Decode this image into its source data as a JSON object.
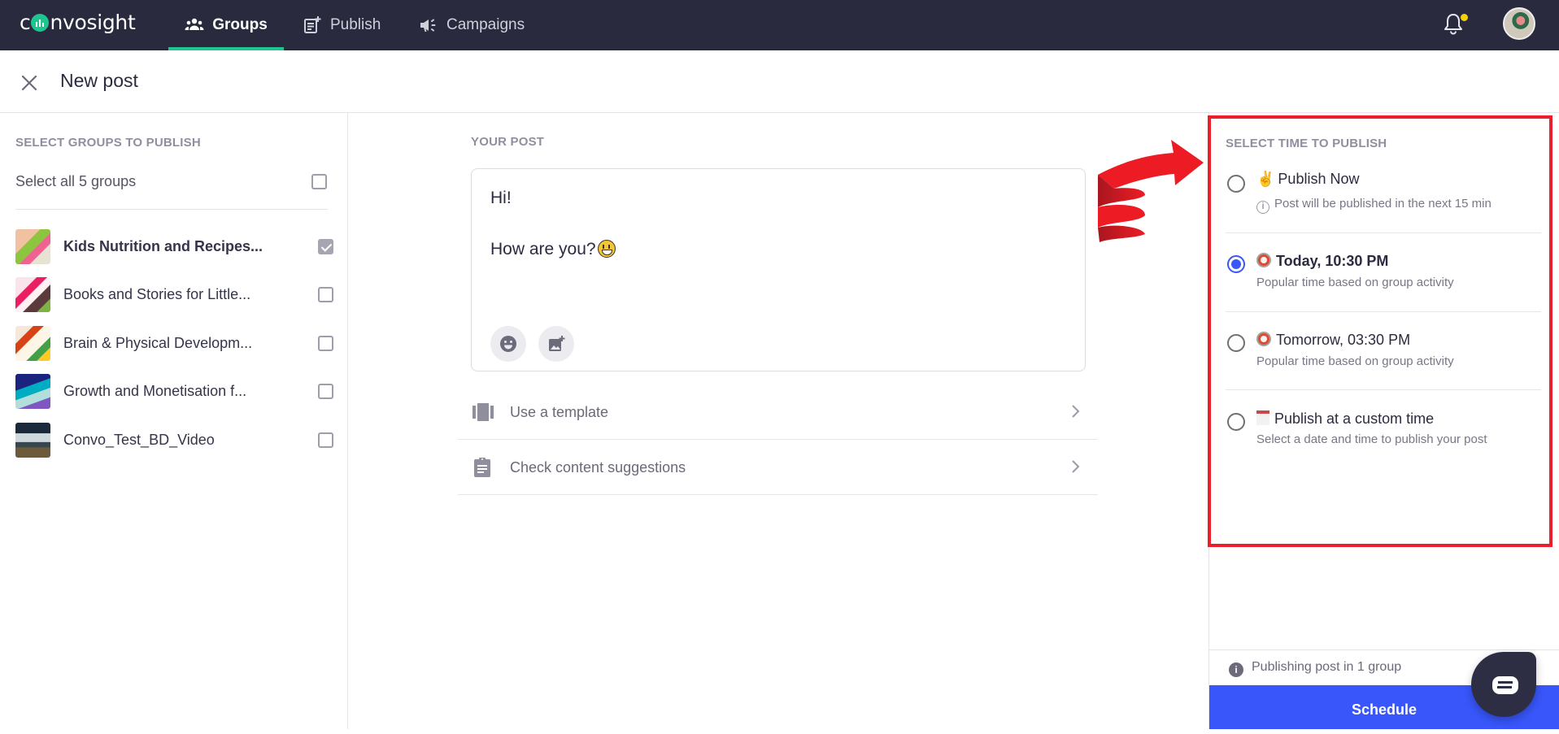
{
  "app": {
    "brand": "convosight",
    "nav": [
      {
        "label": "Groups",
        "icon": "groups-icon",
        "active": true
      },
      {
        "label": "Publish",
        "icon": "publish-icon",
        "active": false
      },
      {
        "label": "Campaigns",
        "icon": "megaphone-icon",
        "active": false
      }
    ],
    "notification_dot": true
  },
  "header": {
    "title": "New post"
  },
  "groups_panel": {
    "label": "SELECT GROUPS TO PUBLISH",
    "select_all": "Select all 5 groups",
    "select_all_checked": false,
    "groups": [
      {
        "name": "Kids Nutrition and Recipes...",
        "checked": true
      },
      {
        "name": "Books and Stories for Little...",
        "checked": false
      },
      {
        "name": "Brain & Physical Developm...",
        "checked": false
      },
      {
        "name": "Growth and Monetisation f...",
        "checked": false
      },
      {
        "name": "Convo_Test_BD_Video",
        "checked": false
      }
    ]
  },
  "post": {
    "label": "YOUR POST",
    "line1": "Hi!",
    "line2": "How are you?",
    "emoji": "grinning-face",
    "actions": [
      {
        "label": "Use a template",
        "icon": "template-icon"
      },
      {
        "label": "Check content suggestions",
        "icon": "clipboard-icon"
      }
    ]
  },
  "schedule_panel": {
    "label": "SELECT TIME TO PUBLISH",
    "options": [
      {
        "title": "Publish Now",
        "emoji": "✌",
        "subtitle": "Post will be published in the next 15 min",
        "selected": false
      },
      {
        "title": "Today, 10:30 PM",
        "emoji": "alarm-clock",
        "subtitle": "Popular time based on group activity",
        "selected": true
      },
      {
        "title": "Tomorrow, 03:30 PM",
        "emoji": "alarm-clock",
        "subtitle": "Popular time based on group activity",
        "selected": false
      },
      {
        "title": "Publish at a custom time",
        "emoji": "calendar",
        "subtitle": "Select a date and time to publish your post",
        "selected": false
      }
    ],
    "footer_note": "Publishing post in 1 group",
    "schedule_button": "Schedule"
  },
  "colors": {
    "topbar": "#292a3e",
    "accent_green": "#1fc58f",
    "primary_blue": "#3856fa",
    "highlight_red": "#ea1f2b"
  }
}
